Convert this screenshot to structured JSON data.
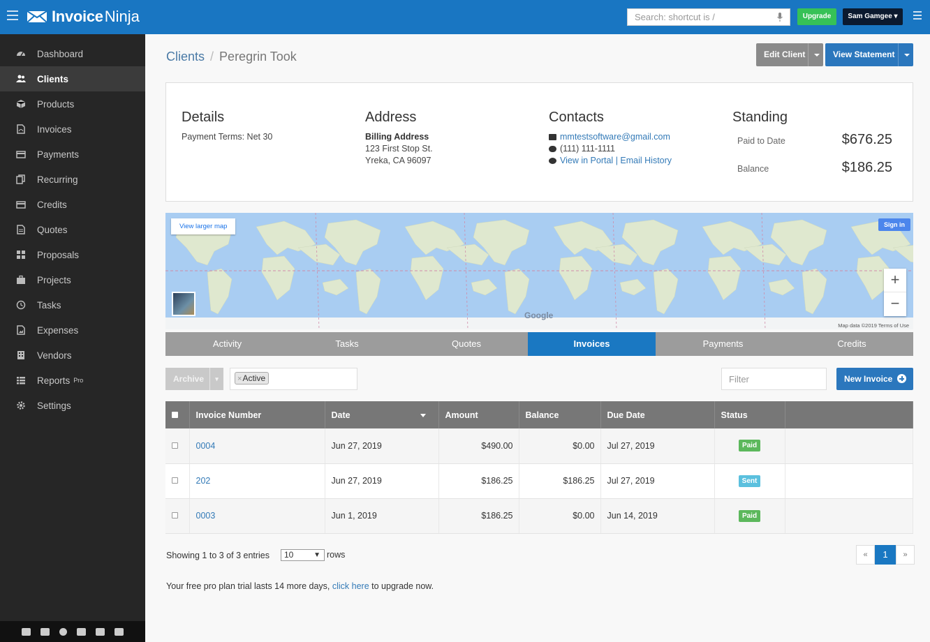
{
  "app": {
    "name_bold": "Invoice",
    "name_light": "Ninja"
  },
  "topbar": {
    "search_placeholder": "Search: shortcut is /",
    "upgrade_label": "Upgrade",
    "user_label": "Sam Gamgee ▾"
  },
  "sidebar": {
    "items": [
      {
        "label": "Dashboard",
        "icon": "dashboard-icon"
      },
      {
        "label": "Clients",
        "icon": "users-icon",
        "active": true
      },
      {
        "label": "Products",
        "icon": "cube-icon"
      },
      {
        "label": "Invoices",
        "icon": "file-pdf-icon"
      },
      {
        "label": "Payments",
        "icon": "credit-card-icon"
      },
      {
        "label": "Recurring",
        "icon": "files-icon"
      },
      {
        "label": "Credits",
        "icon": "credit-card-icon"
      },
      {
        "label": "Quotes",
        "icon": "file-text-icon"
      },
      {
        "label": "Proposals",
        "icon": "th-large-icon"
      },
      {
        "label": "Projects",
        "icon": "briefcase-icon"
      },
      {
        "label": "Tasks",
        "icon": "clock-icon"
      },
      {
        "label": "Expenses",
        "icon": "file-image-icon"
      },
      {
        "label": "Vendors",
        "icon": "building-icon"
      },
      {
        "label": "Reports",
        "icon": "th-list-icon",
        "sup": "Pro"
      },
      {
        "label": "Settings",
        "icon": "cog-icon"
      }
    ]
  },
  "breadcrumb": {
    "parent": "Clients",
    "current": "Peregrin Took"
  },
  "actions": {
    "edit_client": "Edit Client",
    "view_statement": "View Statement"
  },
  "details": {
    "title": "Details",
    "payment_terms": "Payment Terms: Net 30"
  },
  "address": {
    "title": "Address",
    "label": "Billing Address",
    "line1": "123 First Stop St.",
    "line2": "Yreka, CA 96097"
  },
  "contacts": {
    "title": "Contacts",
    "email": "mmtestsoftware@gmail.com",
    "phone": "(111) 111-1111",
    "portal": "View in Portal",
    "sep": "|",
    "email_history": "Email History"
  },
  "standing": {
    "title": "Standing",
    "paid_label": "Paid to Date",
    "paid_value": "$676.25",
    "balance_label": "Balance",
    "balance_value": "$186.25"
  },
  "map": {
    "view_larger": "View larger map",
    "sign_in": "Sign in",
    "zoom_in": "+",
    "zoom_out": "−",
    "google": "Google",
    "attribution": "Map data ©2019   Terms of Use"
  },
  "tabs": [
    {
      "label": "Activity"
    },
    {
      "label": "Tasks"
    },
    {
      "label": "Quotes"
    },
    {
      "label": "Invoices",
      "active": true
    },
    {
      "label": "Payments"
    },
    {
      "label": "Credits"
    }
  ],
  "list_controls": {
    "archive": "Archive",
    "chip_x": "×",
    "chip": "Active",
    "filter_placeholder": "Filter",
    "new_invoice": "New Invoice"
  },
  "table": {
    "headers": [
      "Invoice Number",
      "Date",
      "Amount",
      "Balance",
      "Due Date",
      "Status"
    ],
    "rows": [
      {
        "number": "0004",
        "date": "Jun 27, 2019",
        "amount": "$490.00",
        "balance": "$0.00",
        "due": "Jul 27, 2019",
        "status": "Paid"
      },
      {
        "number": "202",
        "date": "Jun 27, 2019",
        "amount": "$186.25",
        "balance": "$186.25",
        "due": "Jul 27, 2019",
        "status": "Sent"
      },
      {
        "number": "0003",
        "date": "Jun 1, 2019",
        "amount": "$186.25",
        "balance": "$0.00",
        "due": "Jun 14, 2019",
        "status": "Paid"
      }
    ],
    "status_colors": {
      "Paid": "#5cb85c",
      "Sent": "#5bc0de"
    }
  },
  "footer": {
    "showing": "Showing 1 to 3 of 3 entries",
    "rows_value": "10",
    "rows_label": "rows",
    "prev": "«",
    "page": "1",
    "next": "»",
    "trial_pre": "Your free pro plan trial lasts 14 more days,",
    "trial_link": "click here",
    "trial_post": "to upgrade now."
  },
  "colors": {
    "brand": "#1976c2",
    "sidebar": "#262626",
    "tab_active": "#1a78c2"
  }
}
